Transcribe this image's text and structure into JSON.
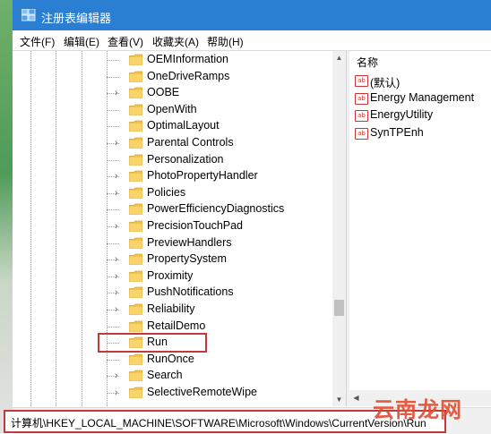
{
  "window": {
    "title": "注册表编辑器",
    "icon": "regedit-icon"
  },
  "menu": [
    {
      "label": "文件(F)"
    },
    {
      "label": "编辑(E)"
    },
    {
      "label": "查看(V)"
    },
    {
      "label": "收藏夹(A)"
    },
    {
      "label": "帮助(H)"
    }
  ],
  "tree": {
    "items": [
      {
        "label": "OEMInformation",
        "expandable": false
      },
      {
        "label": "OneDriveRamps",
        "expandable": false
      },
      {
        "label": "OOBE",
        "expandable": true
      },
      {
        "label": "OpenWith",
        "expandable": false
      },
      {
        "label": "OptimalLayout",
        "expandable": false
      },
      {
        "label": "Parental Controls",
        "expandable": true
      },
      {
        "label": "Personalization",
        "expandable": false
      },
      {
        "label": "PhotoPropertyHandler",
        "expandable": true
      },
      {
        "label": "Policies",
        "expandable": true
      },
      {
        "label": "PowerEfficiencyDiagnostics",
        "expandable": false
      },
      {
        "label": "PrecisionTouchPad",
        "expandable": true
      },
      {
        "label": "PreviewHandlers",
        "expandable": false
      },
      {
        "label": "PropertySystem",
        "expandable": true
      },
      {
        "label": "Proximity",
        "expandable": true
      },
      {
        "label": "PushNotifications",
        "expandable": true
      },
      {
        "label": "Reliability",
        "expandable": true
      },
      {
        "label": "RetailDemo",
        "expandable": false
      },
      {
        "label": "Run",
        "expandable": false,
        "highlighted": true
      },
      {
        "label": "RunOnce",
        "expandable": false
      },
      {
        "label": "Search",
        "expandable": true
      },
      {
        "label": "SelectiveRemoteWipe",
        "expandable": true
      }
    ]
  },
  "values": {
    "column_header": "名称",
    "items": [
      {
        "label": "(默认)",
        "icon": "ab-string-icon"
      },
      {
        "label": "Energy Management",
        "icon": "ab-string-icon"
      },
      {
        "label": "EnergyUtility",
        "icon": "ab-string-icon"
      },
      {
        "label": "SynTPEnh",
        "icon": "ab-string-icon"
      }
    ]
  },
  "statusbar": {
    "path": "计算机\\HKEY_LOCAL_MACHINE\\SOFTWARE\\Microsoft\\Windows\\CurrentVersion\\Run"
  },
  "watermark": "云南龙网",
  "colors": {
    "titlebar": "#2a7fd2",
    "folder": "#f2c44d",
    "highlight_border": "#c0393b",
    "watermark": "#e24b2f"
  }
}
